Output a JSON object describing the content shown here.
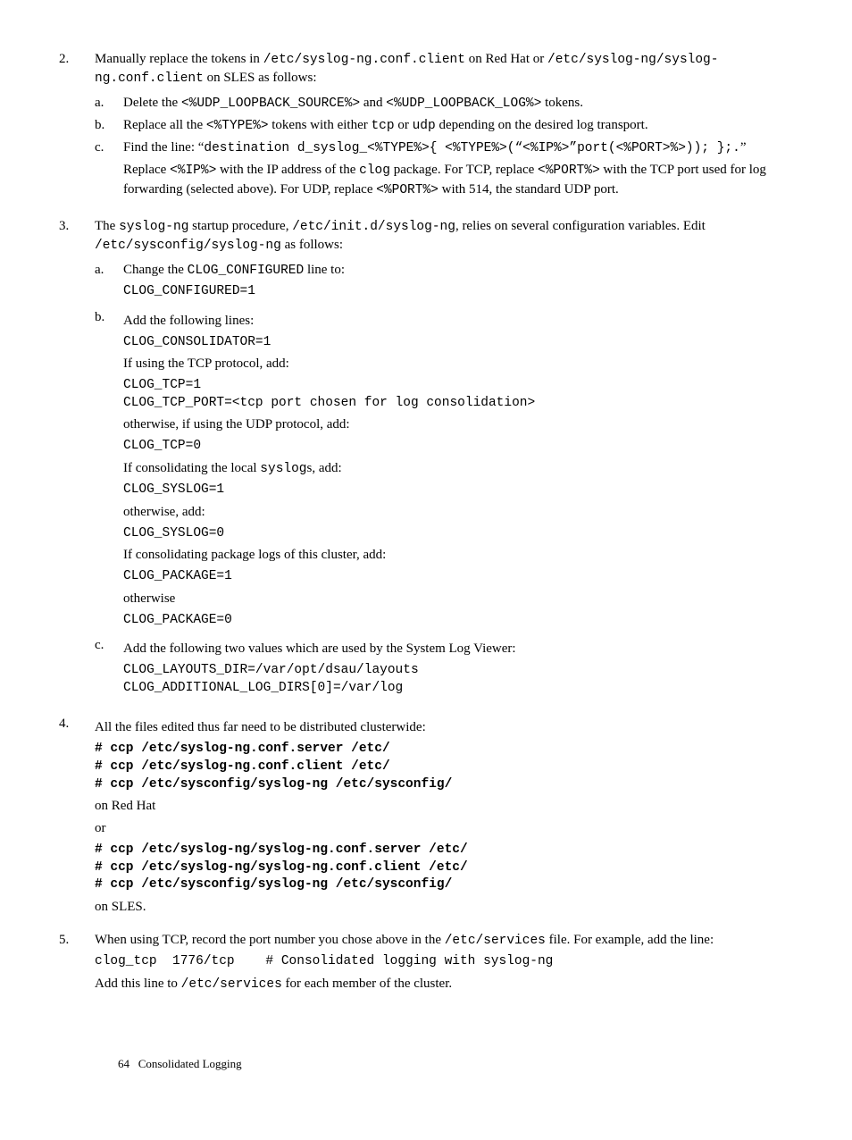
{
  "step2": {
    "num": "2.",
    "intro_a": "Manually replace the tokens in ",
    "intro_code1": "/etc/syslog-ng.conf.client",
    "intro_b": " on Red Hat or ",
    "intro_code2": "/etc/syslog-ng/syslog-ng.conf.client",
    "intro_c": " on SLES as follows:",
    "a": {
      "num": "a.",
      "t1": "Delete the ",
      "c1": "<%UDP_LOOPBACK_SOURCE%>",
      "t2": " and ",
      "c2": "<%UDP_LOOPBACK_LOG%>",
      "t3": " tokens."
    },
    "b": {
      "num": "b.",
      "t1": "Replace all the ",
      "c1": "<%TYPE%>",
      "t2": " tokens with either ",
      "c2": "tcp",
      "t3": " or ",
      "c3": "udp",
      "t4": " depending on the desired log transport."
    },
    "c": {
      "num": "c.",
      "t1": "Find the line: “",
      "c1": "destination d_syslog_<%TYPE%>{ <%TYPE%>(“<%IP%>”port(<%PORT>%>)); };.",
      "t2": "”",
      "p2_t1": "Replace ",
      "p2_c1": "<%IP%>",
      "p2_t2": " with the IP address of the ",
      "p2_c2": "clog",
      "p2_t3": " package. For TCP, replace ",
      "p2_c3": "<%PORT%>",
      "p2_t4": " with the TCP port used for log forwarding (selected above). For UDP, replace ",
      "p2_c4": "<%PORT%>",
      "p2_t5": " with 514, the standard UDP port."
    }
  },
  "step3": {
    "num": "3.",
    "intro_t1": "The ",
    "intro_c1": "syslog-ng",
    "intro_t2": " startup procedure, ",
    "intro_c2": "/etc/init.d/syslog-ng",
    "intro_t3": ", relies on several configuration variables. Edit ",
    "intro_c3": "/etc/sysconfig/syslog-ng",
    "intro_t4": " as follows:",
    "a": {
      "num": "a.",
      "t1": "Change the ",
      "c1": "CLOG_CONFIGURED",
      "t2": " line to:",
      "code": "CLOG_CONFIGURED=1"
    },
    "b": {
      "num": "b.",
      "t1": "Add the following lines:",
      "code1": "CLOG_CONSOLIDATOR=1",
      "p1": "If using the TCP protocol, add:",
      "code2": "CLOG_TCP=1\nCLOG_TCP_PORT=<tcp port chosen for log consolidation>",
      "p2": "otherwise, if using the UDP protocol, add:",
      "code3": "CLOG_TCP=0",
      "p3_t1": "If consolidating the local ",
      "p3_c1": "syslog",
      "p3_t2": "s, add:",
      "code4": "CLOG_SYSLOG=1",
      "p4": "otherwise, add:",
      "code5": "CLOG_SYSLOG=0",
      "p5": "If consolidating package logs of this cluster, add:",
      "code6": "CLOG_PACKAGE=1",
      "p6": "otherwise",
      "code7": "CLOG_PACKAGE=0"
    },
    "c": {
      "num": "c.",
      "t1": "Add the following two values which are used by the System Log Viewer:",
      "code": "CLOG_LAYOUTS_DIR=/var/opt/dsau/layouts\nCLOG_ADDITIONAL_LOG_DIRS[0]=/var/log"
    }
  },
  "step4": {
    "num": "4.",
    "intro": "All the files edited thus far need to be distributed clusterwide:",
    "code1": "# ccp /etc/syslog-ng.conf.server /etc/\n# ccp /etc/syslog-ng.conf.client /etc/\n# ccp /etc/sysconfig/syslog-ng /etc/sysconfig/",
    "p1": "on Red Hat",
    "p2": "or",
    "code2": "# ccp /etc/syslog-ng/syslog-ng.conf.server /etc/\n# ccp /etc/syslog-ng/syslog-ng.conf.client /etc/\n# ccp /etc/sysconfig/syslog-ng /etc/sysconfig/",
    "p3": "on SLES."
  },
  "step5": {
    "num": "5.",
    "intro_t1": "When using TCP, record the port number you chose above in the ",
    "intro_c1": "/etc/services",
    "intro_t2": " file. For example, add the line:",
    "code": "clog_tcp  1776/tcp    # Consolidated logging with syslog-ng",
    "p2_t1": "Add this line to ",
    "p2_c1": "/etc/services",
    "p2_t2": " for each member of the cluster."
  },
  "footer": {
    "page": "64",
    "title": "Consolidated Logging"
  }
}
